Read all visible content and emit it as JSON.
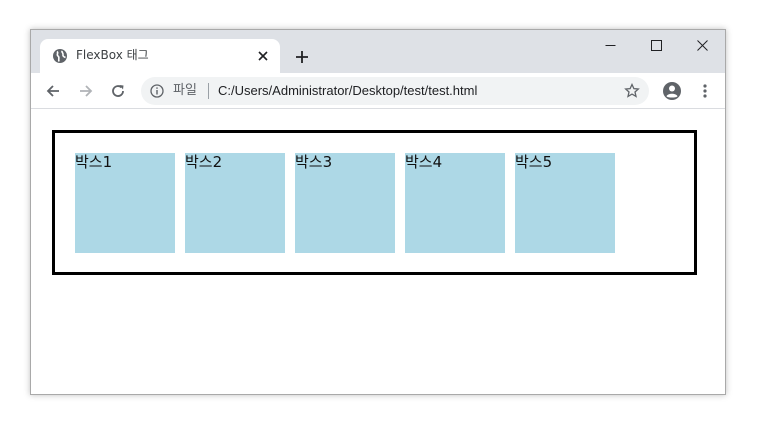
{
  "browser": {
    "tab": {
      "title": "FlexBox 태그",
      "favicon": "globe-icon",
      "close_icon": "close-icon"
    },
    "new_tab_icon": "plus-icon",
    "window_controls": [
      "minimize-icon",
      "maximize-icon",
      "close-icon"
    ],
    "toolbar": {
      "back_icon": "arrow-left-icon",
      "forward_icon": "arrow-right-icon",
      "reload_icon": "reload-icon",
      "security_label": "파일",
      "url": "C:/Users/Administrator/Desktop/test/test.html",
      "bookmark_icon": "star-icon",
      "profile_icon": "account-icon",
      "menu_icon": "kebab-menu-icon"
    }
  },
  "page": {
    "boxes": [
      {
        "label": "박스1"
      },
      {
        "label": "박스2"
      },
      {
        "label": "박스3"
      },
      {
        "label": "박스4"
      },
      {
        "label": "박스5"
      }
    ],
    "colors": {
      "box_background": "#add8e6",
      "container_border": "#000000"
    }
  }
}
